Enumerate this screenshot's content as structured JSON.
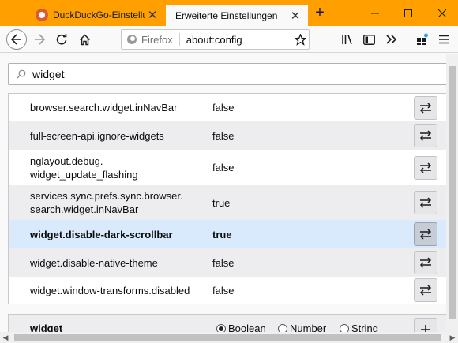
{
  "tabs": [
    {
      "label": "DuckDuckGo-Einstellunge",
      "active": false
    },
    {
      "label": "Erweiterte Einstellungen",
      "active": true
    }
  ],
  "window": {
    "accent": "#ff9f00"
  },
  "urlbar": {
    "identity_label": "Firefox",
    "url": "about:config"
  },
  "search": {
    "value": "widget"
  },
  "prefs": [
    {
      "name": "browser.search.widget.inNavBar",
      "value": "false"
    },
    {
      "name": "full-screen-api.ignore-widgets",
      "value": "false"
    },
    {
      "name": "nglayout.debug.\nwidget_update_flashing",
      "value": "false"
    },
    {
      "name": "services.sync.prefs.sync.browser.\nsearch.widget.inNavBar",
      "value": "true"
    },
    {
      "name": "widget.disable-dark-scrollbar",
      "value": "true",
      "selected": true
    },
    {
      "name": "widget.disable-native-theme",
      "value": "false"
    },
    {
      "name": "widget.window-transforms.disabled",
      "value": "false"
    }
  ],
  "add_pref": {
    "name": "widget",
    "types": [
      {
        "label": "Boolean",
        "selected": true
      },
      {
        "label": "Number",
        "selected": false
      },
      {
        "label": "String",
        "selected": false
      }
    ]
  }
}
